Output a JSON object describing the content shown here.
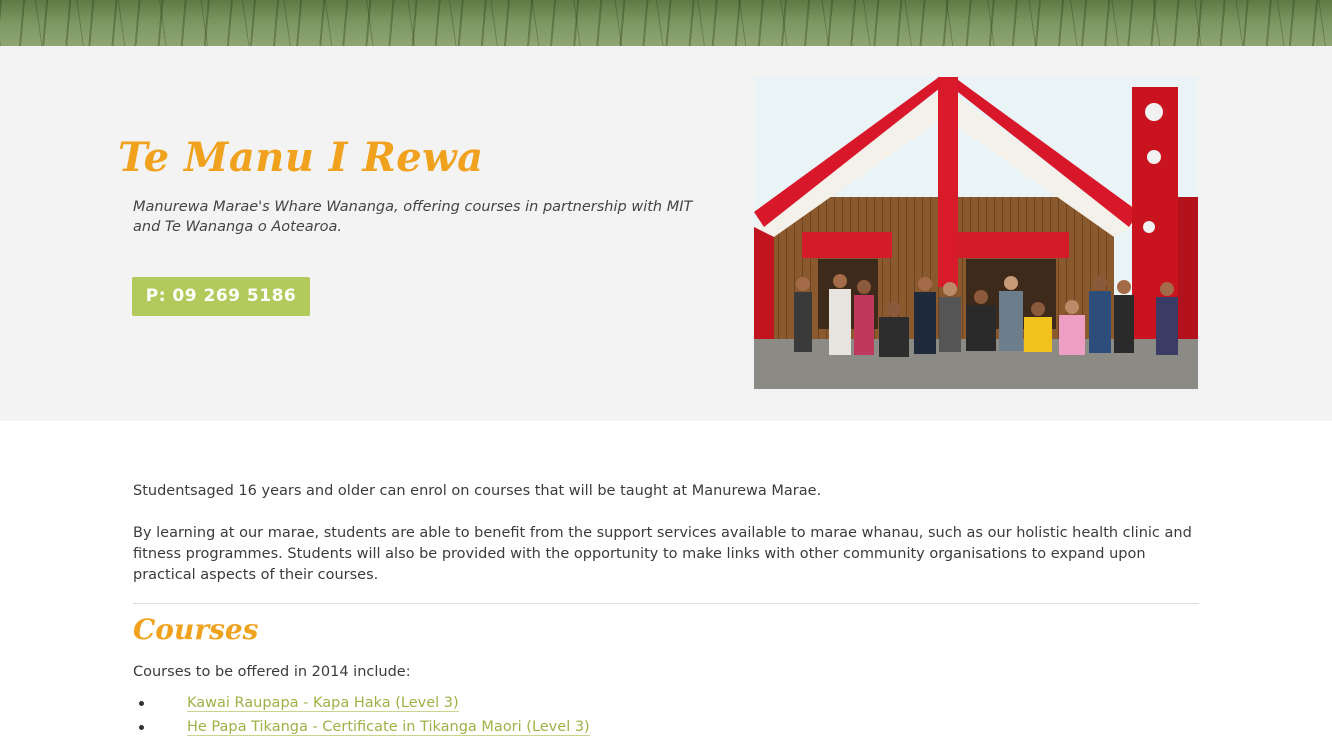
{
  "hero": {
    "title": "Te Manu I Rewa",
    "subtitle": "Manurewa Marae's Whare Wananga, offering courses in partnership with MIT and Te Wananga o Aotearoa.",
    "phone_label": "P: 09 269 5186",
    "accent_color": "#f0a21f",
    "button_color": "#b2ca5c"
  },
  "content": {
    "para1": "Studentsaged 16 years and older can enrol on courses that will be taught at Manurewa Marae.",
    "para2": "By learning at our marae, students are able to benefit from the support services available to marae whanau, such as our holistic health clinic and fitness programmes. Students will also be provided with the opportunity to make links with other community organisations to expand upon practical aspects of their courses.",
    "courses_heading": "Courses",
    "courses_intro": "Courses to be offered in 2014 include:",
    "courses": [
      "Kawai Raupapa - Kapa Haka (Level 3)",
      "He Papa Tikanga - Certificate in Tikanga Maori (Level 3)"
    ],
    "link_color": "#9db246"
  }
}
